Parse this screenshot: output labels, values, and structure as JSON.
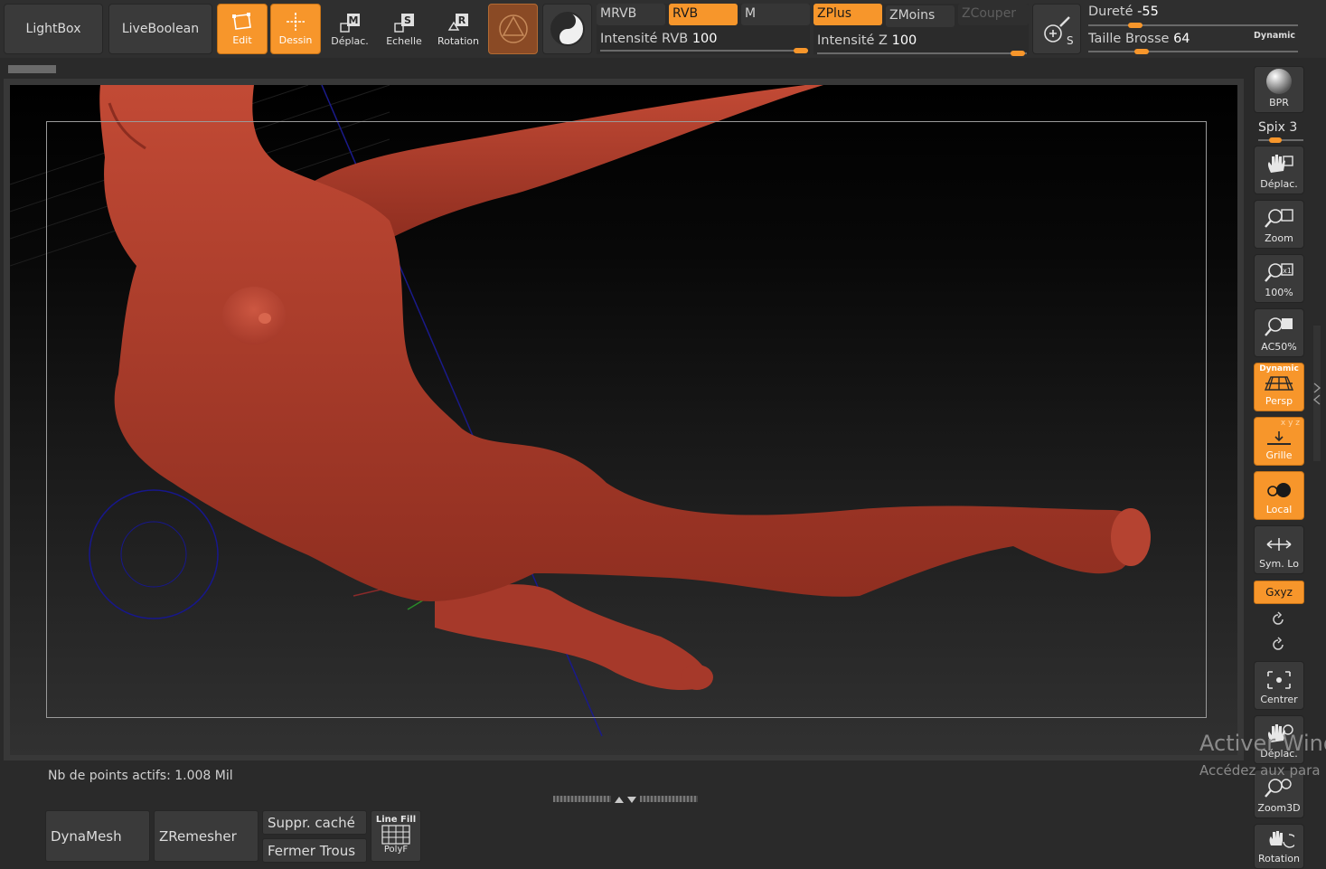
{
  "topbar": {
    "lightbox": "LightBox",
    "liveboolean": "LiveBoolean",
    "tools": {
      "edit": "Edit",
      "draw": "Dessin",
      "move": "Déplac.",
      "scale": "Echelle",
      "rotate": "Rotation"
    },
    "modes": {
      "mrgb": "MRVB",
      "rgb": "RVB",
      "m": "M",
      "zadd": "ZPlus",
      "zsub": "ZMoins",
      "zcut": "ZCouper"
    },
    "rgb_intensity": {
      "label": "Intensité RVB",
      "value": "100"
    },
    "z_intensity": {
      "label": "Intensité Z",
      "value": "100"
    },
    "hardness": {
      "label": "Dureté",
      "value": "-55"
    },
    "brush_size": {
      "label": "Taille Brosse",
      "value": "64"
    },
    "dynamic": "Dynamic"
  },
  "right_shelf": {
    "bpr": "BPR",
    "spix": {
      "label": "Spix",
      "value": "3"
    },
    "move": "Déplac.",
    "zoom": "Zoom",
    "actual": "100%",
    "aahalf": "AC50%",
    "persp_badge": "Dynamic",
    "persp": "Persp",
    "floor": "Grille",
    "local": "Local",
    "lsym": "Sym. Lo",
    "xyz": "Gxyz",
    "frame": "Centrer",
    "move2": "Déplac.",
    "zoom3d": "Zoom3D",
    "rotate": "Rotation"
  },
  "status": {
    "active_points": "Nb de points actifs: 1.008 Mil"
  },
  "bottom": {
    "dynamesh": "DynaMesh",
    "zremesher": "ZRemesher",
    "del_hidden": "Suppr. caché",
    "close_holes": "Fermer Trous",
    "linefill": "Line Fill",
    "polyf": "PolyF"
  },
  "watermark": {
    "line1": "Activer Wind",
    "line2": "Accédez aux para"
  },
  "colors": {
    "accent": "#f7962b",
    "model": "#b83d2c"
  }
}
